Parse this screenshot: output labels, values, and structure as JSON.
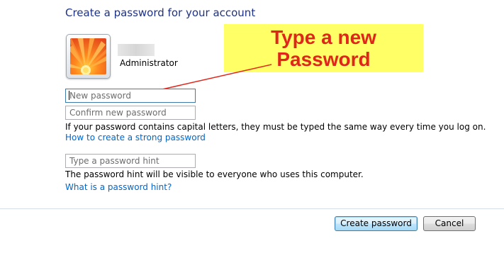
{
  "page": {
    "title": "Create a password for your account"
  },
  "account": {
    "name": "Administrator"
  },
  "annotation": {
    "line1": "Type a new",
    "line2": "Password",
    "highlight_color": "#ffff66",
    "text_color": "#e0251b"
  },
  "form": {
    "new_password": {
      "value": "",
      "placeholder": "New password"
    },
    "confirm_password": {
      "value": "",
      "placeholder": "Confirm new password"
    },
    "capital_letters_note": "If your password contains capital letters, they must be typed the same way every time you log on.",
    "strong_password_link": "How to create a strong password",
    "password_hint": {
      "value": "",
      "placeholder": "Type a password hint"
    },
    "hint_note": "The password hint will be visible to everyone who uses this computer.",
    "hint_link": "What is a password hint?"
  },
  "actions": {
    "create_label": "Create password",
    "cancel_label": "Cancel"
  },
  "colors": {
    "title": "#1e3287",
    "link": "#0066cc"
  },
  "icons": {
    "avatar": "flower-avatar-icon",
    "arrow": "annotation-arrow-icon"
  }
}
